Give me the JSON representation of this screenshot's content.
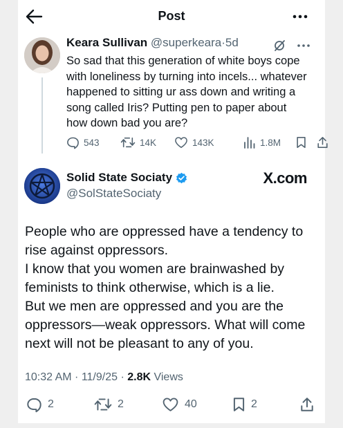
{
  "header": {
    "title": "Post",
    "back_icon": "arrow-left-icon",
    "more_icon": "more-horizontal-icon"
  },
  "reply": {
    "author_name": "Keara Sullivan",
    "author_handle": "@superkeara",
    "separator": "·",
    "time": "5d",
    "text": "So sad that this generation of white boys cope with loneliness by turning into incels... whatever happened to sitting ur ass down and writing a song called Iris? Putting pen to paper about how down bad you are?",
    "actions": {
      "replies": "543",
      "reposts": "14K",
      "likes": "143K",
      "views": "1.8M"
    }
  },
  "post": {
    "author_name": "Solid State Sociaty",
    "author_handle": "@SolStateSociaty",
    "watermark": "X.com",
    "lines": [
      "People who are oppressed have a tendency to",
      "rise against oppressors.",
      "I know that you women are brainwashed by",
      "feminists to think otherwise, which is a lie.",
      "But we men are oppressed and you are the",
      "oppressors—weak oppressors. What will come",
      "next will not be pleasant to any of you."
    ],
    "timestamp": "10:32 AM · 11/9/25 · ",
    "views_count": "2.8K",
    "views_label": " Views",
    "actions": {
      "replies": "2",
      "reposts": "2",
      "likes": "40",
      "bookmarks": "2"
    }
  },
  "colors": {
    "text": "#0f1419",
    "secondary": "#536471",
    "verified": "#1d9bf0"
  }
}
